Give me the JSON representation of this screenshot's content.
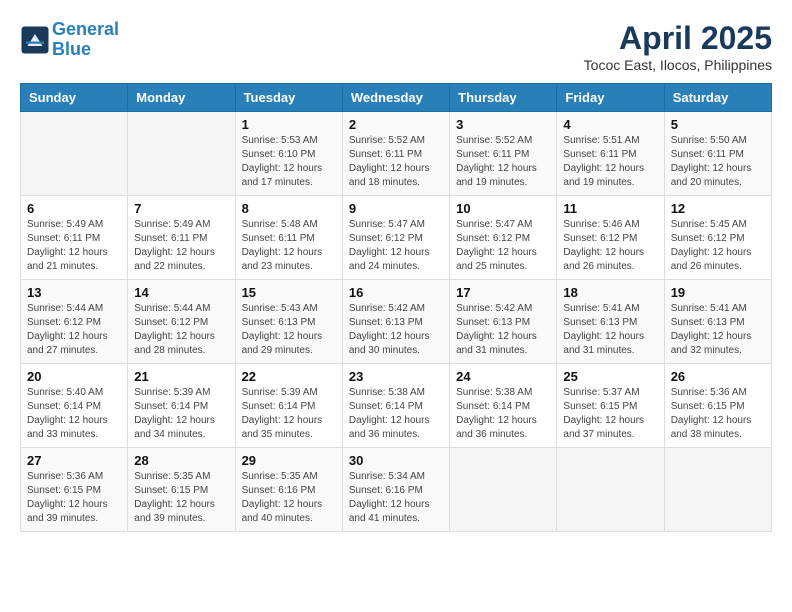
{
  "header": {
    "logo_line1": "General",
    "logo_line2": "Blue",
    "title": "April 2025",
    "subtitle": "Tococ East, Ilocos, Philippines"
  },
  "weekdays": [
    "Sunday",
    "Monday",
    "Tuesday",
    "Wednesday",
    "Thursday",
    "Friday",
    "Saturday"
  ],
  "weeks": [
    [
      {
        "day": "",
        "info": ""
      },
      {
        "day": "",
        "info": ""
      },
      {
        "day": "1",
        "info": "Sunrise: 5:53 AM\nSunset: 6:10 PM\nDaylight: 12 hours and 17 minutes."
      },
      {
        "day": "2",
        "info": "Sunrise: 5:52 AM\nSunset: 6:11 PM\nDaylight: 12 hours and 18 minutes."
      },
      {
        "day": "3",
        "info": "Sunrise: 5:52 AM\nSunset: 6:11 PM\nDaylight: 12 hours and 19 minutes."
      },
      {
        "day": "4",
        "info": "Sunrise: 5:51 AM\nSunset: 6:11 PM\nDaylight: 12 hours and 19 minutes."
      },
      {
        "day": "5",
        "info": "Sunrise: 5:50 AM\nSunset: 6:11 PM\nDaylight: 12 hours and 20 minutes."
      }
    ],
    [
      {
        "day": "6",
        "info": "Sunrise: 5:49 AM\nSunset: 6:11 PM\nDaylight: 12 hours and 21 minutes."
      },
      {
        "day": "7",
        "info": "Sunrise: 5:49 AM\nSunset: 6:11 PM\nDaylight: 12 hours and 22 minutes."
      },
      {
        "day": "8",
        "info": "Sunrise: 5:48 AM\nSunset: 6:11 PM\nDaylight: 12 hours and 23 minutes."
      },
      {
        "day": "9",
        "info": "Sunrise: 5:47 AM\nSunset: 6:12 PM\nDaylight: 12 hours and 24 minutes."
      },
      {
        "day": "10",
        "info": "Sunrise: 5:47 AM\nSunset: 6:12 PM\nDaylight: 12 hours and 25 minutes."
      },
      {
        "day": "11",
        "info": "Sunrise: 5:46 AM\nSunset: 6:12 PM\nDaylight: 12 hours and 26 minutes."
      },
      {
        "day": "12",
        "info": "Sunrise: 5:45 AM\nSunset: 6:12 PM\nDaylight: 12 hours and 26 minutes."
      }
    ],
    [
      {
        "day": "13",
        "info": "Sunrise: 5:44 AM\nSunset: 6:12 PM\nDaylight: 12 hours and 27 minutes."
      },
      {
        "day": "14",
        "info": "Sunrise: 5:44 AM\nSunset: 6:12 PM\nDaylight: 12 hours and 28 minutes."
      },
      {
        "day": "15",
        "info": "Sunrise: 5:43 AM\nSunset: 6:13 PM\nDaylight: 12 hours and 29 minutes."
      },
      {
        "day": "16",
        "info": "Sunrise: 5:42 AM\nSunset: 6:13 PM\nDaylight: 12 hours and 30 minutes."
      },
      {
        "day": "17",
        "info": "Sunrise: 5:42 AM\nSunset: 6:13 PM\nDaylight: 12 hours and 31 minutes."
      },
      {
        "day": "18",
        "info": "Sunrise: 5:41 AM\nSunset: 6:13 PM\nDaylight: 12 hours and 31 minutes."
      },
      {
        "day": "19",
        "info": "Sunrise: 5:41 AM\nSunset: 6:13 PM\nDaylight: 12 hours and 32 minutes."
      }
    ],
    [
      {
        "day": "20",
        "info": "Sunrise: 5:40 AM\nSunset: 6:14 PM\nDaylight: 12 hours and 33 minutes."
      },
      {
        "day": "21",
        "info": "Sunrise: 5:39 AM\nSunset: 6:14 PM\nDaylight: 12 hours and 34 minutes."
      },
      {
        "day": "22",
        "info": "Sunrise: 5:39 AM\nSunset: 6:14 PM\nDaylight: 12 hours and 35 minutes."
      },
      {
        "day": "23",
        "info": "Sunrise: 5:38 AM\nSunset: 6:14 PM\nDaylight: 12 hours and 36 minutes."
      },
      {
        "day": "24",
        "info": "Sunrise: 5:38 AM\nSunset: 6:14 PM\nDaylight: 12 hours and 36 minutes."
      },
      {
        "day": "25",
        "info": "Sunrise: 5:37 AM\nSunset: 6:15 PM\nDaylight: 12 hours and 37 minutes."
      },
      {
        "day": "26",
        "info": "Sunrise: 5:36 AM\nSunset: 6:15 PM\nDaylight: 12 hours and 38 minutes."
      }
    ],
    [
      {
        "day": "27",
        "info": "Sunrise: 5:36 AM\nSunset: 6:15 PM\nDaylight: 12 hours and 39 minutes."
      },
      {
        "day": "28",
        "info": "Sunrise: 5:35 AM\nSunset: 6:15 PM\nDaylight: 12 hours and 39 minutes."
      },
      {
        "day": "29",
        "info": "Sunrise: 5:35 AM\nSunset: 6:16 PM\nDaylight: 12 hours and 40 minutes."
      },
      {
        "day": "30",
        "info": "Sunrise: 5:34 AM\nSunset: 6:16 PM\nDaylight: 12 hours and 41 minutes."
      },
      {
        "day": "",
        "info": ""
      },
      {
        "day": "",
        "info": ""
      },
      {
        "day": "",
        "info": ""
      }
    ]
  ]
}
